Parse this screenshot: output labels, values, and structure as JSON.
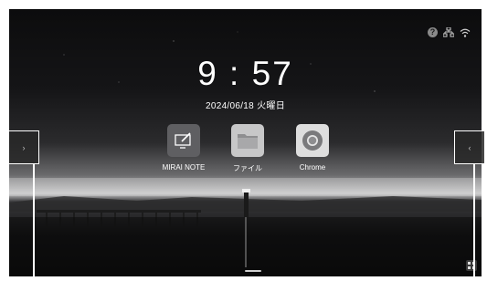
{
  "clock": {
    "time": "9 : 57",
    "date": "2024/06/18  火曜日"
  },
  "status_bar": {
    "icons": [
      "help-icon",
      "network-icon",
      "wifi-icon"
    ],
    "help_glyph": "?"
  },
  "apps": [
    {
      "label": "MIRAI NOTE",
      "icon": "mirai-note-icon"
    },
    {
      "label": "ファイル",
      "icon": "file-folder-icon"
    },
    {
      "label": "Chrome",
      "icon": "chrome-icon"
    }
  ],
  "edge_handles": {
    "left_glyph": "›",
    "right_glyph": "‹"
  },
  "colors": {
    "accent": "#ffffff",
    "background_dark": "#0c0c0d",
    "horizon_glow": "#c9c9ca"
  }
}
